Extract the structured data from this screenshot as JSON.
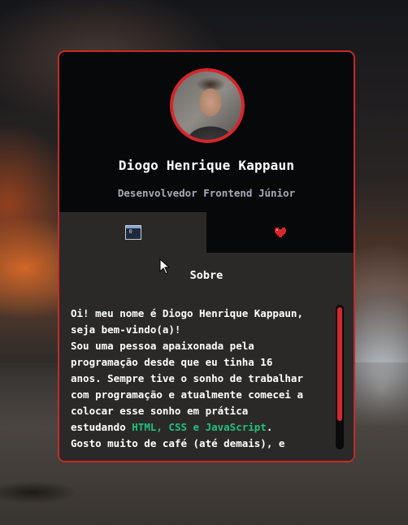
{
  "profile": {
    "name": "Diogo Henrique Kappaun",
    "role": "Desenvolvedor Frontend Júnior"
  },
  "tabs": [
    {
      "icon": "window-icon",
      "active": true
    },
    {
      "icon": "heart-icon",
      "active": false
    }
  ],
  "panel": {
    "title": "Sobre",
    "lines": [
      "Oi! meu nome é Diogo Henrique Kappaun,",
      "seja bem-vindo(a)!",
      "Sou uma pessoa apaixonada pela",
      "programação desde que eu tinha 16",
      "anos. Sempre tive o sonho de trabalhar",
      "com programação e atualmente comecei a",
      "colocar esse sonho em prática"
    ],
    "studying_prefix": "estudando ",
    "studying_highlight": "HTML, CSS e JavaScript",
    "studying_suffix": ".",
    "last_line": "Gosto muito de café (até demais), e"
  },
  "colors": {
    "accent": "#c62a2a",
    "highlight": "#22c07a",
    "card_bg": "#070809",
    "panel_bg": "#2a2928"
  }
}
